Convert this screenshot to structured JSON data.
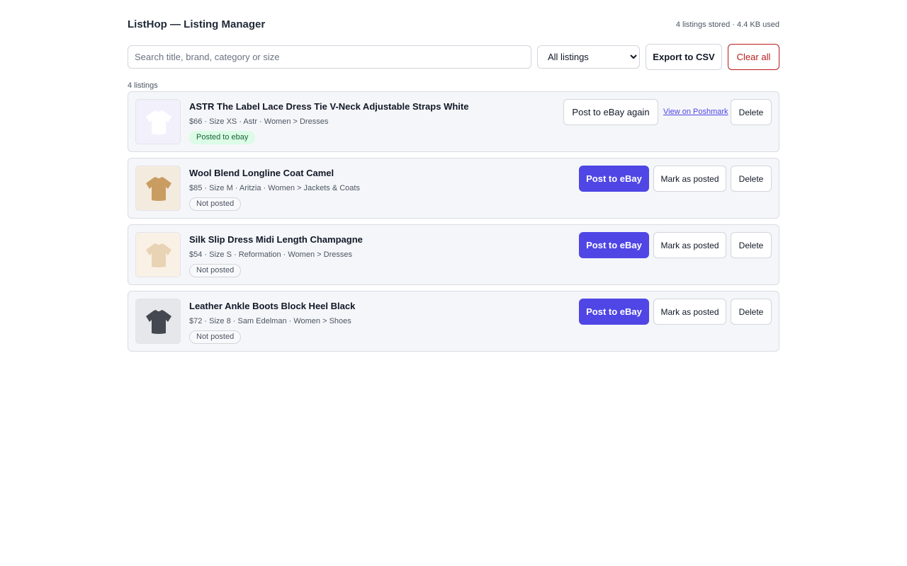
{
  "header": {
    "title": "ListHop — Listing Manager",
    "storage_info": "4 listings stored · 4.4 KB used"
  },
  "toolbar": {
    "search_placeholder": "Search title, brand, category or size",
    "search_value": "",
    "filter_selected": "All listings",
    "export_label": "Export to CSV",
    "clear_label": "Clear all"
  },
  "count_label": "4 listings",
  "colors": {
    "accent": "#4f46e5",
    "danger": "#b91c1c",
    "posted_badge_bg": "#dcfce7",
    "posted_badge_text": "#166534"
  },
  "listings": [
    {
      "title": "ASTR The Label Lace Dress Tie V-Neck Adjustable Straps White",
      "meta": "$66 · Size XS · Astr · Women > Dresses",
      "status": "Posted to ebay",
      "thumb_icon": "shirt-icon",
      "thumb_bg": "#f2f1fb",
      "thumb_color": "#ffffff",
      "primary_action": "Post to eBay again",
      "secondary_action": "View on Poshmark",
      "delete_label": "Delete"
    },
    {
      "title": "Wool Blend Longline Coat Camel",
      "meta": "$85 · Size M · Aritzia · Women > Jackets & Coats",
      "status": "Not posted",
      "thumb_icon": "shirt-icon",
      "thumb_bg": "#f4ebdf",
      "thumb_color": "#c99c62",
      "primary_action": "Post to eBay",
      "secondary_action": "Mark as posted",
      "delete_label": "Delete"
    },
    {
      "title": "Silk Slip Dress Midi Length Champagne",
      "meta": "$54 · Size S · Reformation · Women > Dresses",
      "status": "Not posted",
      "thumb_icon": "shirt-icon",
      "thumb_bg": "#faf1e6",
      "thumb_color": "#e8d3b4",
      "primary_action": "Post to eBay",
      "secondary_action": "Mark as posted",
      "delete_label": "Delete"
    },
    {
      "title": "Leather Ankle Boots Block Heel Black",
      "meta": "$72 · Size 8 · Sam Edelman · Women > Shoes",
      "status": "Not posted",
      "thumb_icon": "shirt-icon",
      "thumb_bg": "#e5e7eb",
      "thumb_color": "#444851",
      "primary_action": "Post to eBay",
      "secondary_action": "Mark as posted",
      "delete_label": "Delete"
    }
  ]
}
